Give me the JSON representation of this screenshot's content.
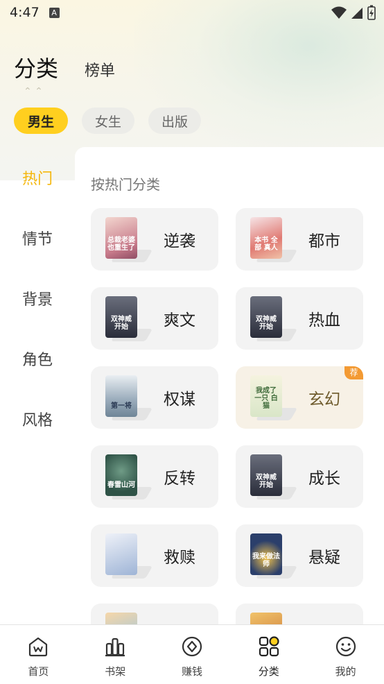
{
  "status_bar": {
    "time": "4:47",
    "notification_icon": "A"
  },
  "top_tabs": {
    "active": "分类",
    "other": "榜单"
  },
  "gender_tabs": [
    "男生",
    "女生",
    "出版"
  ],
  "side_nav": [
    "热门",
    "情节",
    "背景",
    "角色",
    "风格"
  ],
  "section_title": "按热门分类",
  "categories": [
    {
      "label": "逆袭",
      "cover_text": "总裁老婆 也重生了",
      "cover_color": "#c77a8a"
    },
    {
      "label": "都市",
      "cover_text": "本书 全部 真人",
      "cover_color": "#e07a73"
    },
    {
      "label": "爽文",
      "cover_text": "双神威 开始",
      "cover_color": "#2a2d3a"
    },
    {
      "label": "热血",
      "cover_text": "双神威 开始",
      "cover_color": "#2a2d3a"
    },
    {
      "label": "权谋",
      "cover_text": "第一将",
      "cover_color": "#6f8597"
    },
    {
      "label": "玄幻",
      "cover_text": "我成了 一只 白猫",
      "cover_color": "#d9e6c8",
      "badge": "荐"
    },
    {
      "label": "反转",
      "cover_text": "春雷山河",
      "cover_color": "#2f5347"
    },
    {
      "label": "成长",
      "cover_text": "双神威 开始",
      "cover_color": "#2a2d3a"
    },
    {
      "label": "救赎",
      "cover_text": "",
      "cover_color": "#9eb4d6"
    },
    {
      "label": "悬疑",
      "cover_text": "我来做法师",
      "cover_color": "#2b3f6b"
    }
  ],
  "bottom_nav": [
    {
      "label": "首页",
      "icon": "home-icon"
    },
    {
      "label": "书架",
      "icon": "bookshelf-icon"
    },
    {
      "label": "赚钱",
      "icon": "earn-icon"
    },
    {
      "label": "分类",
      "icon": "category-icon",
      "active": true
    },
    {
      "label": "我的",
      "icon": "profile-icon"
    }
  ],
  "colors": {
    "accent": "#ffcf1f",
    "active_text": "#f5b70c",
    "badge": "#f39a33"
  }
}
